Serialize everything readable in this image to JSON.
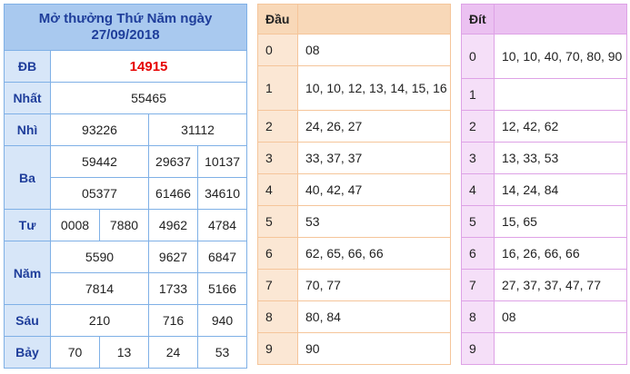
{
  "results": {
    "title_line1": "Mở thưởng Thứ Năm ngày",
    "title_line2": "27/09/2018",
    "prizes": {
      "db": {
        "label": "ĐB",
        "values": [
          "14915"
        ]
      },
      "nhat": {
        "label": "Nhất",
        "values": [
          "55465"
        ]
      },
      "nhi": {
        "label": "Nhì",
        "values": [
          "93226",
          "31112"
        ]
      },
      "ba": {
        "label": "Ba",
        "values": [
          "59442",
          "29637",
          "10137",
          "05377",
          "61466",
          "34610"
        ]
      },
      "tu": {
        "label": "Tư",
        "values": [
          "0008",
          "7880",
          "4962",
          "4784"
        ]
      },
      "nam": {
        "label": "Năm",
        "values": [
          "5590",
          "9627",
          "6847",
          "7814",
          "1733",
          "5166"
        ]
      },
      "sau": {
        "label": "Sáu",
        "values": [
          "210",
          "716",
          "940"
        ]
      },
      "bay": {
        "label": "Bảy",
        "values": [
          "70",
          "13",
          "24",
          "53"
        ]
      }
    }
  },
  "dau": {
    "header": "Đầu",
    "rows": [
      {
        "k": "0",
        "v": "08"
      },
      {
        "k": "1",
        "v": "10, 10, 12, 13, 14, 15, 16"
      },
      {
        "k": "2",
        "v": "24, 26, 27"
      },
      {
        "k": "3",
        "v": "33, 37, 37"
      },
      {
        "k": "4",
        "v": "40, 42, 47"
      },
      {
        "k": "5",
        "v": "53"
      },
      {
        "k": "6",
        "v": "62, 65, 66, 66"
      },
      {
        "k": "7",
        "v": "70, 77"
      },
      {
        "k": "8",
        "v": "80, 84"
      },
      {
        "k": "9",
        "v": "90"
      }
    ]
  },
  "dit": {
    "header": "Đít",
    "rows": [
      {
        "k": "0",
        "v": "10, 10, 40, 70, 80, 90"
      },
      {
        "k": "1",
        "v": ""
      },
      {
        "k": "2",
        "v": "12, 42, 62"
      },
      {
        "k": "3",
        "v": "13, 33, 53"
      },
      {
        "k": "4",
        "v": "14, 24, 84"
      },
      {
        "k": "5",
        "v": "15, 65"
      },
      {
        "k": "6",
        "v": "16, 26, 66, 66"
      },
      {
        "k": "7",
        "v": "27, 37, 37, 47, 77"
      },
      {
        "k": "8",
        "v": "08"
      },
      {
        "k": "9",
        "v": ""
      }
    ]
  }
}
